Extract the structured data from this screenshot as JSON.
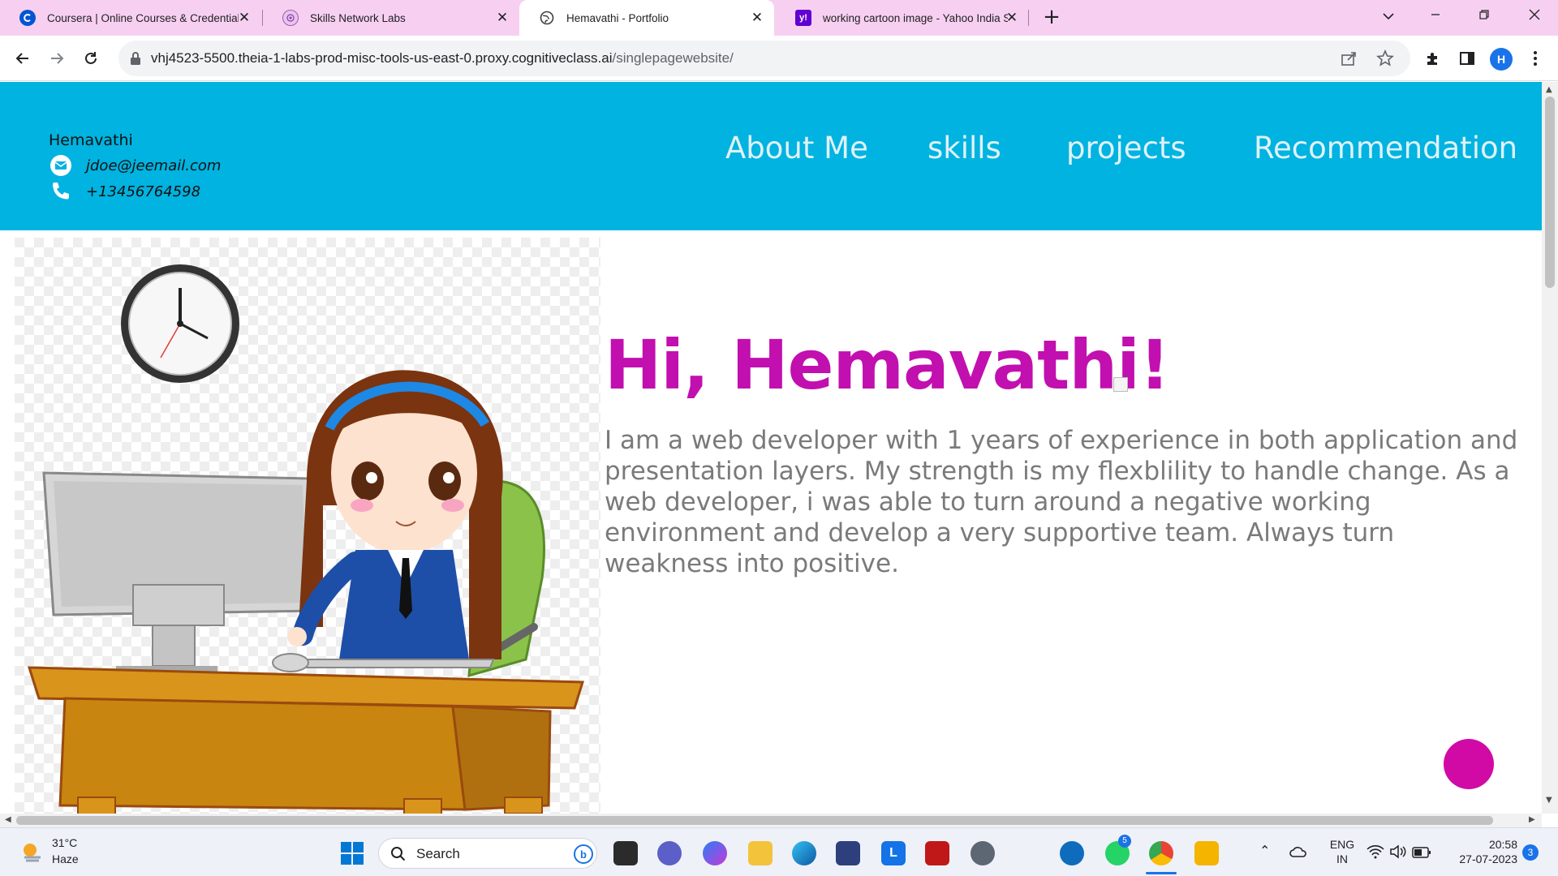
{
  "browser": {
    "tabs": [
      {
        "title": "Coursera | Online Courses & Credentials",
        "icon": "coursera-icon",
        "active": false
      },
      {
        "title": "Skills Network Labs",
        "icon": "skills-network-icon",
        "active": false
      },
      {
        "title": "Hemavathi - Portfolio",
        "icon": "globe-icon",
        "active": true
      },
      {
        "title": "working cartoon image - Yahoo India Search Results",
        "icon": "yahoo-icon",
        "active": false
      }
    ],
    "new_tab": "+",
    "url_host": "vhj4523-5500.theia-1-labs-prod-misc-tools-us-east-0.proxy.cognitiveclass.ai",
    "url_path": "/singlepagewebsite/",
    "profile_initial": "H"
  },
  "site": {
    "header": {
      "name": "Hemavathi",
      "email": "jdoe@jeemail.com",
      "phone": "+13456764598",
      "bg_color": "#00b3e0"
    },
    "nav": [
      "About Me",
      "skills",
      "projects",
      "Recommendation"
    ],
    "hero": {
      "title": "Hi, Hemavathi!",
      "title_color": "#c20faf",
      "description": "I am a web developer with 1 years of experience in both application and presentation layers. My strength is my flexblility to handle change. As a web developer, i was able to turn around a negative working environment and develop a very supportive team. Always turn weakness into positive."
    },
    "fab_color": "#d10aa6"
  },
  "taskbar": {
    "weather_temp": "31°C",
    "weather_cond": "Haze",
    "search_label": "Search",
    "lang_top": "ENG",
    "lang_bottom": "IN",
    "time": "20:58",
    "date": "27-07-2023",
    "notifications": "3",
    "whatsapp_badge": "5"
  }
}
